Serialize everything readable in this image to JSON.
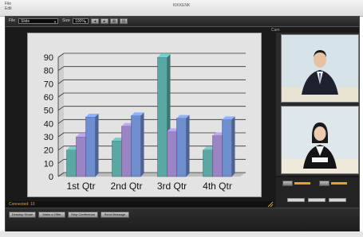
{
  "window": {
    "title": "KIKKENK",
    "menu_lines": [
      "File",
      "Edit"
    ]
  },
  "toolbar": {
    "label1": "File",
    "select1_value": "Slide",
    "label2": "Size",
    "select2_value": "100%",
    "buttons": [
      "◂",
      "▸",
      "⊞",
      "⊟"
    ],
    "panel_label": "Cam"
  },
  "chart_data": {
    "type": "bar",
    "categories": [
      "1st Qtr",
      "2nd Qtr",
      "3rd Qtr",
      "4th Qtr"
    ],
    "series": [
      {
        "values": [
          20,
          27,
          90,
          20
        ],
        "color": "#5aa8a4"
      },
      {
        "values": [
          30,
          38,
          34,
          31
        ],
        "color": "#9a84c6"
      },
      {
        "values": [
          45,
          46,
          44,
          43
        ],
        "color": "#6e8ed0"
      }
    ],
    "ylim": [
      0,
      90
    ],
    "yticks": [
      0,
      10,
      20,
      30,
      40,
      50,
      60,
      70,
      80,
      90
    ],
    "grid": true,
    "title": "",
    "xlabel": "",
    "ylabel": ""
  },
  "status": {
    "text": "Connected: 10"
  },
  "bottom_buttons": [
    "Desktop Share",
    "Make a Offer",
    "Stop Conference",
    "Send Message"
  ],
  "colors": {
    "accent": "#e8a21e",
    "app_bg": "#1a1a1a",
    "chart_bg": "#e3e3e3"
  }
}
